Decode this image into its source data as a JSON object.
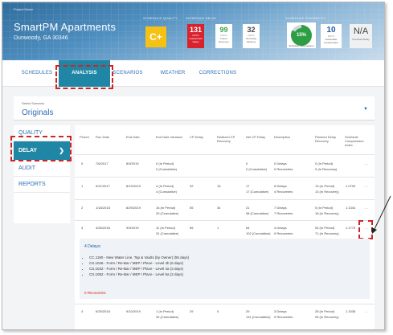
{
  "header": {
    "project_small": "Project Name",
    "project_name": "SmartPM Apartments",
    "project_location": "Dunwoody, GA 30346",
    "quality": {
      "label": "Schedule Quality",
      "grade": "C+"
    },
    "delay": {
      "label": "Schedule Delay",
      "boxes": [
        {
          "num": "131",
          "unit": "DAYS",
          "caption": "Critical Path Delay"
        },
        {
          "num": "99",
          "unit": "DAYS",
          "caption": "Future Recovery"
        },
        {
          "num": "32",
          "unit": "DAYS",
          "caption": "Net Delay Variance"
        }
      ]
    },
    "feasibility": {
      "label": "Schedule Feasibility",
      "gauge_value": "15%",
      "gauge_caption": "Schedule Compression",
      "box2": {
        "num": "10",
        "unit": "DAYS",
        "caption": "Achievable Compression"
      },
      "box3": {
        "num": "N/A",
        "caption": "Predicted Delay"
      }
    }
  },
  "tabs": [
    {
      "label": "SCHEDULES"
    },
    {
      "label": "ANALYSIS"
    },
    {
      "label": "SCENARIOS"
    },
    {
      "label": "WEATHER"
    },
    {
      "label": "CORRECTIONS"
    }
  ],
  "scenario": {
    "label": "Select Scenario",
    "value": "Originals"
  },
  "leftnav": [
    {
      "label": "QUALITY"
    },
    {
      "label": "DELAY"
    },
    {
      "label": "AUDIT"
    },
    {
      "label": "REPORTS"
    }
  ],
  "table": {
    "headers": [
      "Period",
      "Run Date",
      "End Date",
      "End Date Variance",
      "CP Delay",
      "Realized CP Recovery",
      "Net CP Delay",
      "Description",
      "Planned Delay Recovery",
      "Schedule Compression Index"
    ],
    "rows": [
      {
        "period": "0",
        "run": "7/6/2017",
        "end": "8/9/2019",
        "var1": "0 (In Period)",
        "var2": "0 (Cumulative)",
        "cp": "",
        "rec": "",
        "net1": "0",
        "net2": "0 (Cumulative)",
        "desc1": "0 Delays",
        "desc2": "0 Recoveries",
        "pl1": "0 (In Period)",
        "pl2": "0 (In Recovery)",
        "sci": ""
      },
      {
        "period": "1",
        "run": "9/21/2017",
        "end": "8/13/2019",
        "var1": "4 (In Period)",
        "var2": "4 (Cumulative)",
        "cp": "32",
        "rec": "15",
        "net1": "17",
        "net2": "17 (Cumulative)",
        "desc1": "6 Delays",
        "desc2": "4 Recoveries",
        "pl1": "13 (In Period)",
        "pl2": "13 (In Recovery)",
        "sci": "1.0709"
      },
      {
        "period": "2",
        "run": "1/18/2018",
        "end": "8/29/2019",
        "var1": "16 (In Period)",
        "var2": "20 (Cumulative)",
        "cp": "55",
        "rec": "34",
        "net1": "21",
        "net2": "38 (Cumulative)",
        "desc1": "7 Delays",
        "desc2": "7 Recoveries",
        "pl1": "5 (In Period)",
        "pl2": "18 (In Recovery)",
        "sci": "1.1344"
      },
      {
        "period": "3",
        "run": "4/26/2018",
        "end": "9/9/2019",
        "var1": "11 (In Period)",
        "var2": "31 (Cumulative)",
        "cp": "65",
        "rec": "1",
        "net1": "64",
        "net2": "102 (Cumulative)",
        "desc1": "4 Delays",
        "desc2": "0 Recoveries",
        "pl1": "53 (In Period)",
        "pl2": "71 (In Recovery)",
        "sci": "1.1775"
      },
      {
        "period": "4",
        "run": "6/25/2018",
        "end": "9/10/2019",
        "var1": "1 (In Period)",
        "var2": "32 (Cumulative)",
        "cp": "29",
        "rec": "0",
        "net1": "29",
        "net2": "131 (Cumulative)",
        "desc1": "3 Delays",
        "desc2": "0 Recoveries",
        "pl1": "28 (In Period)",
        "pl2": "99 (In Recovery)",
        "sci": "1.1538"
      }
    ],
    "expanded": {
      "heading": "4 Delays:",
      "items": [
        "CC.1190 - New Water Line, Tap & Vaults (by Owner) (55 days)",
        "CS.1046 - Form / Re-Bar / MEP / Place - Level 4b (6 days)",
        "CS.1042 - Form / Re-Bar / MEP / Place - Level 4a (3 days)",
        "CS.1052 - Form / Re-Bar / MEP / Place - Level 5a (2 days)"
      ],
      "recoveries": "0 Recoveries:"
    }
  },
  "colors": {
    "accent": "#1f86a5",
    "link": "#2c6fb5",
    "highlight": "#d02424",
    "grade": "#f5c214",
    "delay_red": "#d8232f",
    "gauge_green": "#2e9e44"
  },
  "icons": {
    "nav_chevron": "chevron-right-icon",
    "row_menu": "more-dots-icon",
    "dropdown": "caret-down-icon"
  }
}
